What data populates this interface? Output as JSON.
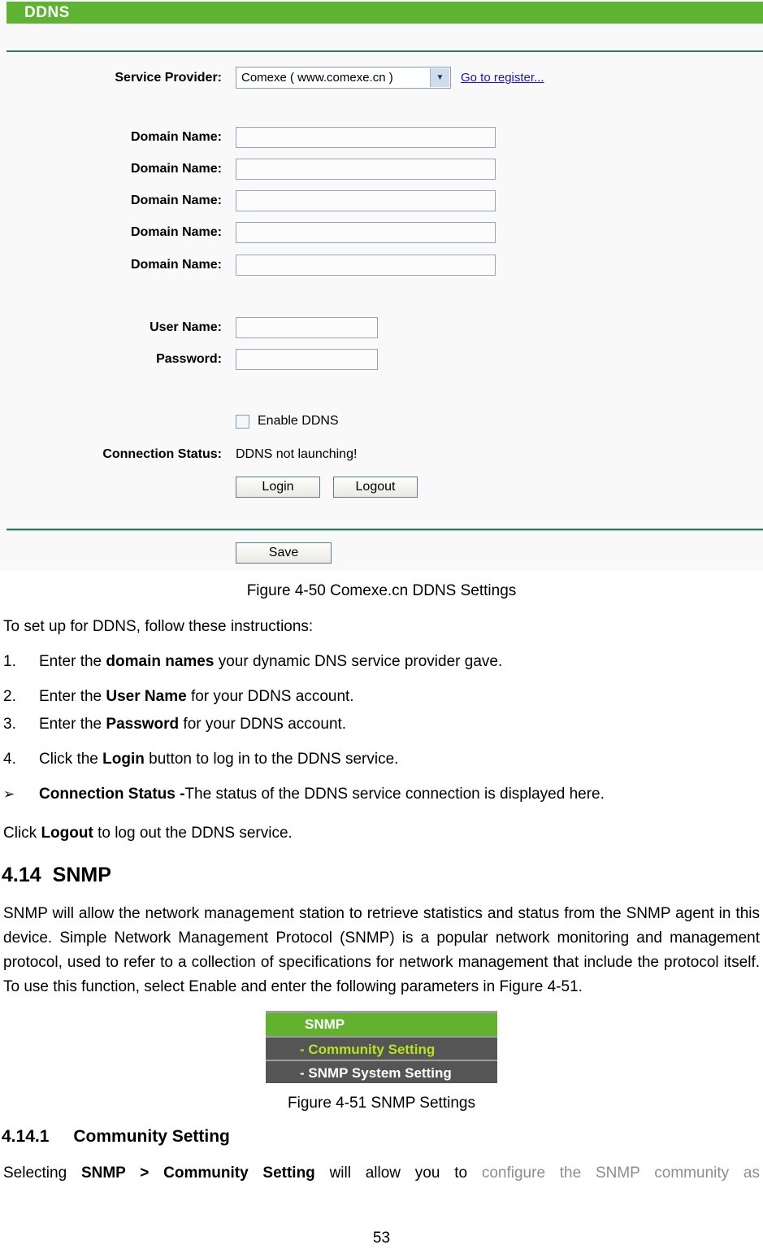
{
  "router_panel": {
    "header_title": "DDNS",
    "service_provider": {
      "label": "Service Provider:",
      "selected": "Comexe ( www.comexe.cn )",
      "options": [
        "Comexe ( www.comexe.cn )"
      ],
      "register_link": "Go to register..."
    },
    "domain_rows": [
      {
        "label": "Domain Name:",
        "value": ""
      },
      {
        "label": "Domain Name:",
        "value": ""
      },
      {
        "label": "Domain Name:",
        "value": ""
      },
      {
        "label": "Domain Name:",
        "value": ""
      },
      {
        "label": "Domain Name:",
        "value": ""
      }
    ],
    "user_name": {
      "label": "User Name:",
      "value": ""
    },
    "password": {
      "label": "Password:",
      "value": ""
    },
    "enable_ddns": {
      "label": "Enable DDNS",
      "checked": false
    },
    "connection_status": {
      "label": "Connection Status:",
      "value": "DDNS not launching!"
    },
    "buttons": {
      "login": "Login",
      "logout": "Logout",
      "save": "Save"
    },
    "colors": {
      "header_green": "#5fb333",
      "rule_green": "#2e7a63",
      "input_border": "#8fa8bc",
      "link_blue": "#1515cf"
    }
  },
  "document": {
    "figure_50_caption": "Figure 4-50 Comexe.cn DDNS Settings",
    "intro": "To set up for DDNS, follow these instructions:",
    "steps": [
      {
        "num": "1.",
        "pre": "Enter the ",
        "bold": "domain names",
        "post": " your dynamic DNS service provider gave."
      },
      {
        "num": "2.",
        "pre": "Enter the ",
        "bold": "User Name",
        "post": " for your DDNS account."
      },
      {
        "num": "3.",
        "pre": "Enter the ",
        "bold": "Password",
        "post": " for your DDNS account."
      },
      {
        "num": "4.",
        "pre": "Click the ",
        "bold": "Login",
        "post": " button to log in to the DDNS service."
      }
    ],
    "bullet": {
      "marker": "➢",
      "bold": "Connection Status -",
      "text": "The status of the DDNS service connection is displayed here."
    },
    "logout_line": {
      "pre": "Click ",
      "bold": "Logout",
      "post": " to log out the DDNS service."
    },
    "section": {
      "number": "4.14",
      "title": "SNMP"
    },
    "snmp_paragraph": "SNMP will allow the network management station to retrieve statistics and status from the SNMP agent in this device. Simple Network Management Protocol (SNMP) is a popular network monitoring and management protocol, used to refer to a collection of specifications for network management that include the protocol itself. To use this function, select Enable and enter the following parameters in Figure 4-51.",
    "snmp_menu": {
      "header": "SNMP",
      "items": [
        {
          "label": "- Community Setting",
          "state": "active"
        },
        {
          "label": "- SNMP System Setting",
          "state": "plain"
        }
      ]
    },
    "figure_51_caption": "Figure 4-51 SNMP Settings",
    "subsection": {
      "number": "4.14.1",
      "title": "Community Setting"
    },
    "community_paragraph": {
      "pre": "Selecting ",
      "bold": "SNMP > Community Setting",
      "mid": " will allow you to ",
      "dim": "configure the SNMP community as"
    },
    "page_number": "53"
  }
}
